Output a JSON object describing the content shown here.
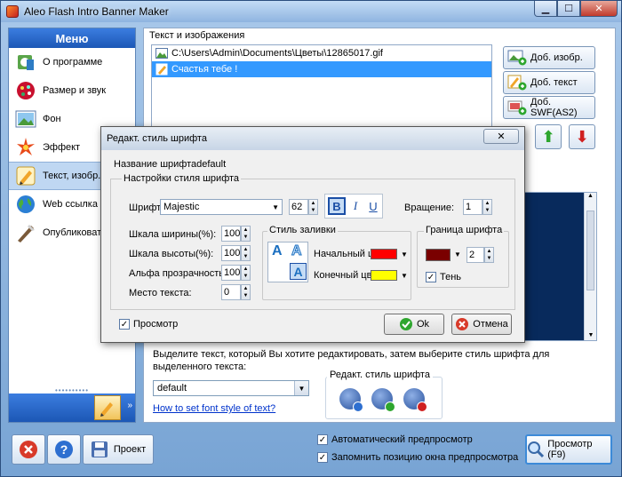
{
  "window": {
    "title": "Aleo Flash Intro Banner Maker"
  },
  "menu": {
    "header": "Меню",
    "items": [
      {
        "label": "О программе",
        "icon": "info-icon"
      },
      {
        "label": "Размер и звук",
        "icon": "size-sound-icon"
      },
      {
        "label": "Фон",
        "icon": "background-icon"
      },
      {
        "label": "Эффект",
        "icon": "effect-icon"
      },
      {
        "label": "Текст, изобр., S",
        "icon": "text-image-icon",
        "selected": true
      },
      {
        "label": "Web ссылка",
        "icon": "globe-icon"
      },
      {
        "label": "Опубликовать ф",
        "icon": "publish-icon"
      }
    ]
  },
  "panel": {
    "title": "Текст и изображения",
    "list": [
      {
        "text": "C:\\Users\\Admin\\Documents\\Цветы\\12865017.gif",
        "icon": "image-icon"
      },
      {
        "text": "Счастья тебе !",
        "icon": "text-icon",
        "selected": true
      }
    ],
    "buttons": {
      "add_image": "Доб. изобр.",
      "add_text": "Доб. текст",
      "add_swf": "Доб. SWF(AS2)"
    },
    "instructions": "Выделите текст, который Вы хотите редактировать, затем выберите стиль шрифта для выделенного текста:",
    "style_select": "default",
    "howto_link": "How to set font style of text?",
    "edit_style_group": "Редакт. стиль шрифта"
  },
  "bottom": {
    "project_label": "Проект",
    "auto_preview": "Автоматический предпросмотр",
    "remember_pos": "Запомнить позицию окна предпросмотра",
    "preview_label": "Просмотр (F9)"
  },
  "dialog": {
    "title": "Редакт. стиль шрифта",
    "font_name_label": "Название шрифта",
    "font_name_value": "default",
    "settings_group": "Настройки стиля шрифта",
    "font_label": "Шрифт:",
    "font_value": "Majestic",
    "font_size": "62",
    "bold": "B",
    "italic": "I",
    "underline": "U",
    "rotation_label": "Вращение:",
    "rotation_value": "1",
    "width_scale_label": "Шкала ширины(%):",
    "width_scale_value": "100",
    "height_scale_label": "Шкала высоты(%):",
    "height_scale_value": "100",
    "alpha_label": "Альфа прозрачность(%",
    "alpha_value": "100",
    "position_label": "Место текста:",
    "position_value": "0",
    "fill_group": "Стиль заливки",
    "fill_glyph": "A",
    "start_color_label": "Начальный цве",
    "end_color_label": "Конечный цвет",
    "border_group": "Граница шрифта",
    "border_width": "2",
    "shadow_label": "Тень",
    "preview_label": "Просмотр",
    "ok_label": "Ok",
    "cancel_label": "Отмена",
    "colors": {
      "start": "#ff0000",
      "end": "#ffff00",
      "border": "#7a0000"
    }
  }
}
